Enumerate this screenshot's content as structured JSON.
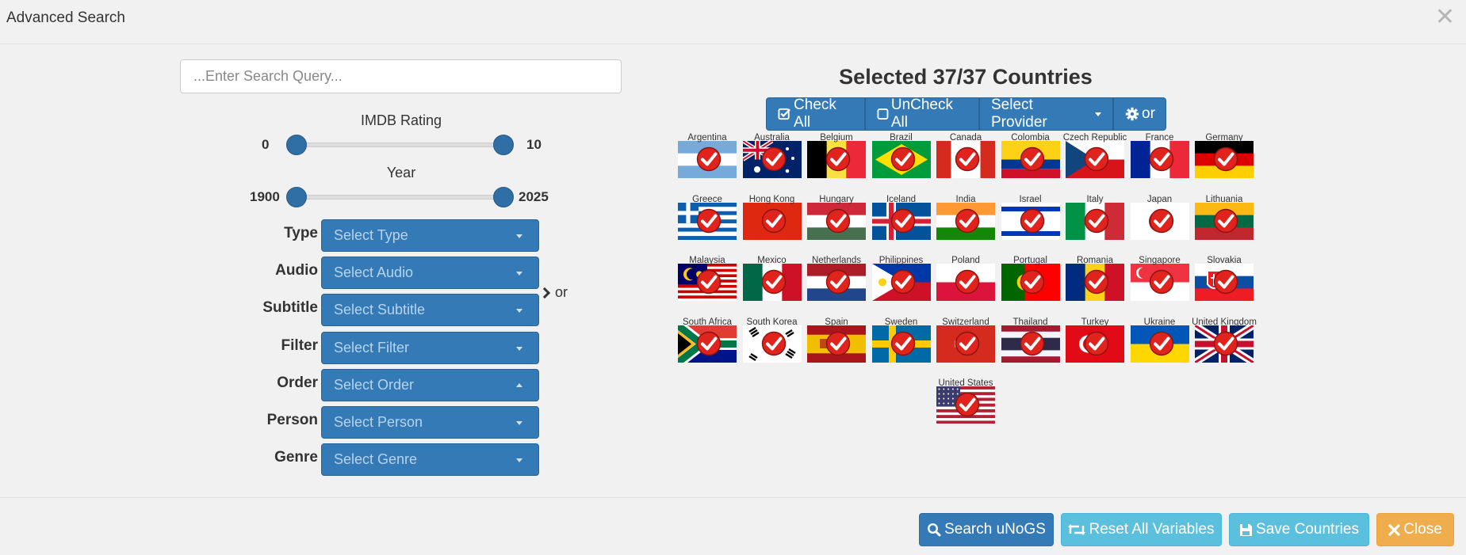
{
  "header": {
    "title": "Advanced Search",
    "close_symbol": "✕"
  },
  "search": {
    "placeholder": "...Enter Search Query..."
  },
  "imdb": {
    "label": "IMDB Rating",
    "min": "0",
    "max": "10",
    "low": 0,
    "high": 10
  },
  "year": {
    "label": "Year",
    "min": "1900",
    "max": "2025",
    "low": 1900,
    "high": 2025
  },
  "filters": [
    {
      "label": "Type",
      "placeholder": "Select Type"
    },
    {
      "label": "Audio",
      "placeholder": "Select Audio"
    },
    {
      "label": "Subtitle",
      "placeholder": "Select Subtitle"
    },
    {
      "label": "Filter",
      "placeholder": "Select Filter"
    },
    {
      "label": "Order",
      "placeholder": "Select Order"
    },
    {
      "label": "Person",
      "placeholder": "Select Person"
    },
    {
      "label": "Genre",
      "placeholder": "Select Genre"
    }
  ],
  "or_label": "or",
  "countries_panel": {
    "title": "Selected 37/37 Countries",
    "check_all": "Check All",
    "uncheck_all": "UnCheck All",
    "select_provider": "Select Provider",
    "or_toggle": "or",
    "countries": [
      "Argentina",
      "Australia",
      "Belgium",
      "Brazil",
      "Canada",
      "Colombia",
      "Czech Republic",
      "France",
      "Germany",
      "Greece",
      "Hong Kong",
      "Hungary",
      "Iceland",
      "India",
      "Israel",
      "Italy",
      "Japan",
      "Lithuania",
      "Malaysia",
      "Mexico",
      "Netherlands",
      "Philippines",
      "Poland",
      "Portugal",
      "Romania",
      "Singapore",
      "Slovakia",
      "South Africa",
      "South Korea",
      "Spain",
      "Sweden",
      "Switzerland",
      "Thailand",
      "Turkey",
      "Ukraine",
      "United Kingdom",
      "United States"
    ]
  },
  "footer": {
    "search": "Search uNoGS",
    "reset": "Reset All Variables",
    "save": "Save Countries",
    "close": "Close"
  },
  "colors": {
    "primary": "#337ab7",
    "info": "#5bc0de",
    "warning": "#f0ad4e",
    "check": "#e0231c"
  }
}
